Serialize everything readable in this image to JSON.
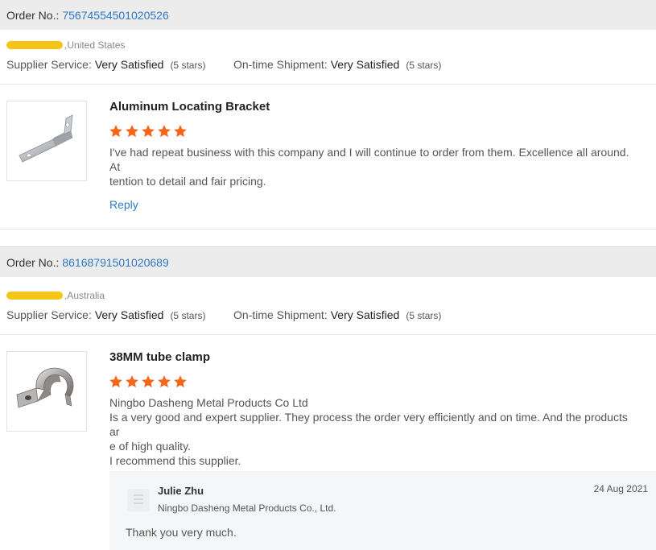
{
  "reviews": [
    {
      "order_label": "Order No.:",
      "order_number": "75674554501020526",
      "buyer_country": ",United States",
      "supplier_service_label": "Supplier Service:",
      "supplier_service_value": "Very Satisfied",
      "supplier_service_stars": "(5 stars)",
      "shipment_label": "On-time Shipment:",
      "shipment_value": "Very Satisfied",
      "shipment_stars": "(5 stars)",
      "product_title": "Aluminum Locating Bracket",
      "rating": 5,
      "comment_line1": "I've had repeat business with this company and I will continue to order from them. Excellence all around. At",
      "comment_line2": "tention to detail and fair pricing.",
      "reply_label": "Reply"
    },
    {
      "order_label": "Order No.:",
      "order_number": "86168791501020689",
      "buyer_country": ",Australia",
      "supplier_service_label": "Supplier Service:",
      "supplier_service_value": "Very Satisfied",
      "supplier_service_stars": "(5 stars)",
      "shipment_label": "On-time Shipment:",
      "shipment_value": "Very Satisfied",
      "shipment_stars": "(5 stars)",
      "product_title": "38MM tube clamp",
      "rating": 5,
      "comment_line1": "Ningbo Dasheng Metal Products Co Ltd",
      "comment_line2": "Is a very good and expert supplier. They process the order very efficiently and on time. And the products ar",
      "comment_line3": "e of high quality.",
      "comment_line4": "I recommend this supplier.",
      "supplier_reply": {
        "name": "Julie Zhu",
        "company": "Ningbo Dasheng Metal Products Co., Ltd.",
        "date": "24 Aug 2021",
        "message": "Thank you very much."
      }
    }
  ],
  "colors": {
    "star": "#f5661d",
    "link": "#2c79c4",
    "header_bg": "#ececec",
    "redaction": "#f5c518"
  }
}
